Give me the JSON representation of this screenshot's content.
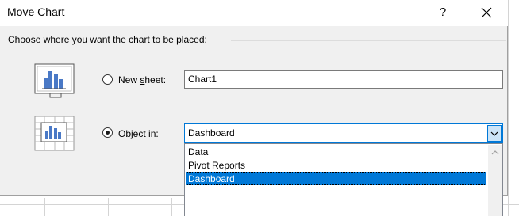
{
  "dialog": {
    "title": "Move Chart",
    "help_label": "?",
    "close_label": "Close",
    "section_label": "Choose where you want the chart to be placed:"
  },
  "options": {
    "new_sheet": {
      "label_prefix": "New ",
      "label_accel": "s",
      "label_suffix": "heet:",
      "checked": false,
      "value": "Chart1"
    },
    "object_in": {
      "label_accel": "O",
      "label_suffix": "bject in:",
      "checked": true,
      "value": "Dashboard",
      "options": [
        "Data",
        "Pivot Reports",
        "Dashboard"
      ]
    }
  },
  "colors": {
    "accent": "#0078d7",
    "dialog_bg": "#f0f0f0"
  }
}
